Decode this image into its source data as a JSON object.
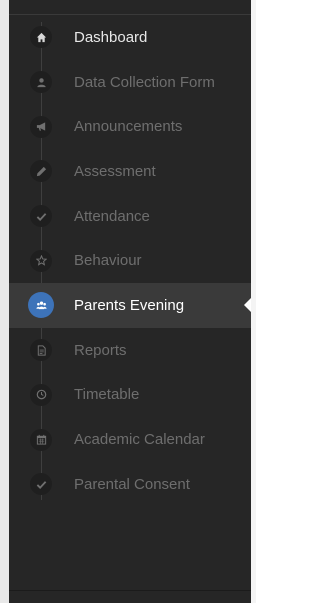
{
  "sidebar": {
    "items": [
      {
        "label": "Dashboard",
        "icon": "home-icon"
      },
      {
        "label": "Data Collection Form",
        "icon": "user-icon"
      },
      {
        "label": "Announcements",
        "icon": "megaphone-icon"
      },
      {
        "label": "Assessment",
        "icon": "pencil-icon"
      },
      {
        "label": "Attendance",
        "icon": "check-icon"
      },
      {
        "label": "Behaviour",
        "icon": "star-icon"
      },
      {
        "label": "Parents Evening",
        "icon": "users-icon",
        "active": true
      },
      {
        "label": "Reports",
        "icon": "document-icon"
      },
      {
        "label": "Timetable",
        "icon": "clock-icon"
      },
      {
        "label": "Academic Calendar",
        "icon": "calendar-icon"
      },
      {
        "label": "Parental Consent",
        "icon": "check-icon"
      }
    ]
  },
  "colors": {
    "sidebar_bg": "#262626",
    "active_bg": "#3a3a3a",
    "accent": "#3d73b9",
    "label_muted": "#6e6e6e",
    "label_active": "#ffffff"
  }
}
